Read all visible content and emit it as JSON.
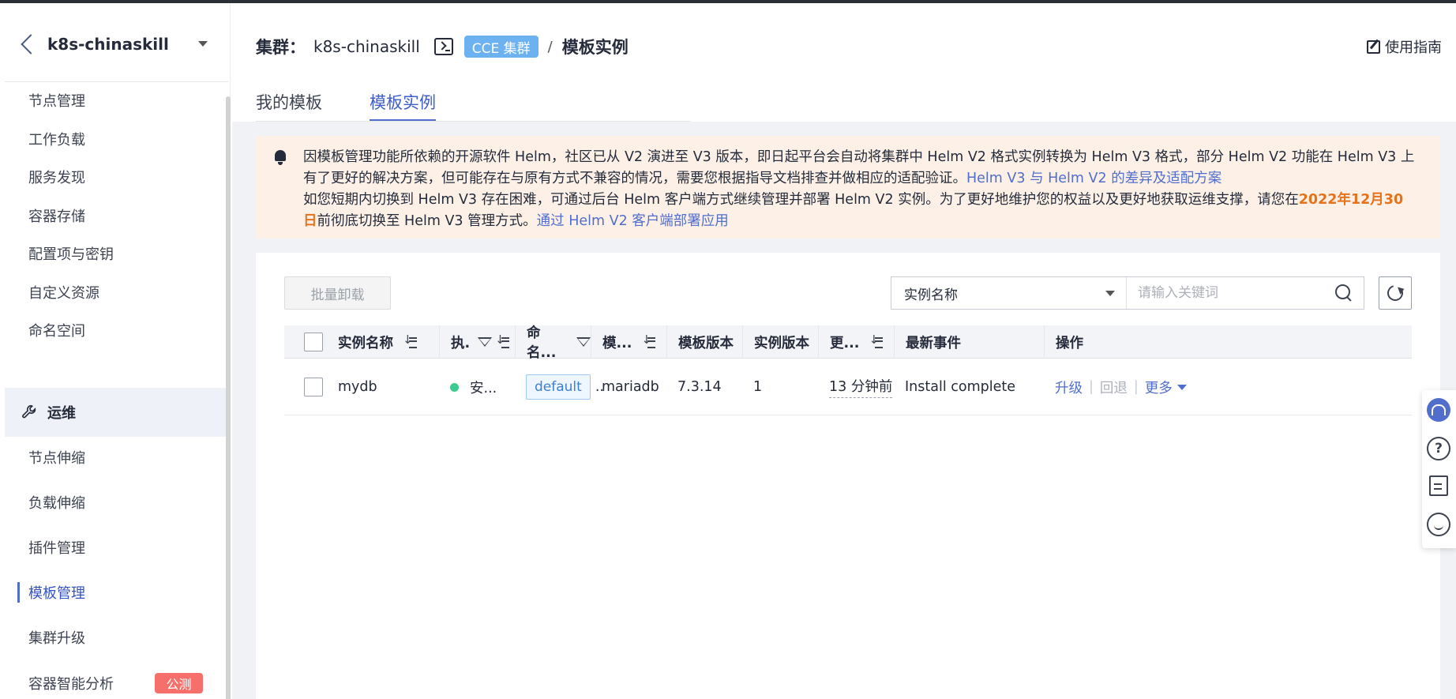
{
  "sidebar": {
    "cluster_name": "k8s-chinaskill",
    "items": [
      {
        "label": "节点管理"
      },
      {
        "label": "工作负载"
      },
      {
        "label": "服务发现"
      },
      {
        "label": "容器存储"
      },
      {
        "label": "配置项与密钥"
      },
      {
        "label": "自定义资源"
      },
      {
        "label": "命名空间"
      }
    ],
    "group_label": "运维",
    "group_items": [
      {
        "label": "节点伸缩"
      },
      {
        "label": "负载伸缩"
      },
      {
        "label": "插件管理"
      },
      {
        "label": "模板管理",
        "active": true
      },
      {
        "label": "集群升级"
      },
      {
        "label": "容器智能分析"
      }
    ],
    "beta_badge": "公测"
  },
  "header": {
    "cluster_label": "集群：",
    "cluster_name": "k8s-chinaskill",
    "cluster_tag": "CCE 集群",
    "separator": "/",
    "current_page": "模板实例",
    "guide_label": "使用指南"
  },
  "tabs": [
    {
      "label": "我的模板",
      "active": false
    },
    {
      "label": "模板实例",
      "active": true
    }
  ],
  "notice": {
    "line1": "因模板管理功能所依赖的开源软件 Helm，社区已从 V2 演进至 V3 版本，即日起平台会自动将集群中 Helm V2 格式实例转换为 Helm V3 格式，部分 Helm V2 功能在 Helm V3 上有了更好的解决方案，但可能存在与原有方式不兼容的情况，需要您根据指导文档排查并做相应的适配验证。",
    "link1": "Helm V3 与 Helm V2 的差异及适配方案",
    "line2_pre": "如您短期内切换到 Helm V3 存在困难，可通过后台 Helm 客户端方式继续管理并部署 Helm V2 实例。为了更好地维护您的权益以及更好地获取运维支撑，请您在",
    "deadline": "2022年12月30日",
    "line2_post": "前彻底切换至 Helm V3 管理方式。",
    "link2": "通过 Helm V2 客户端部署应用"
  },
  "toolbar": {
    "batch_uninstall_label": "批量卸载",
    "search_field_selected": "实例名称",
    "search_placeholder": "请输入关键词"
  },
  "table": {
    "headers": {
      "name": "实例名称",
      "status": "执.",
      "namespace": "命名...",
      "template": "模...",
      "template_version": "模板版本",
      "instance_version": "实例版本",
      "updated": "更...",
      "latest_event": "最新事件",
      "actions": "操作"
    },
    "rows": [
      {
        "name": "mydb",
        "status": "安...",
        "namespace": "default",
        "namespace_more": "..",
        "template": "mariadb",
        "template_version": "7.3.14",
        "instance_version": "1",
        "updated": "13 分钟前",
        "latest_event": "Install complete",
        "action_upgrade": "升级",
        "action_rollback": "回退",
        "action_more": "更多"
      }
    ]
  },
  "colors": {
    "accent": "#526ecc",
    "status_ok": "#3dcc8e",
    "deadline": "#e5731e",
    "notice_bg": "#fdf1e7",
    "badge": "#f66f6a"
  },
  "icons": {
    "back": "chevron-left-icon",
    "dropdown": "caret-down-icon",
    "terminal": "terminal-icon",
    "guide": "edit-doc-icon",
    "notice": "bell-icon",
    "search": "search-icon",
    "refresh": "refresh-icon",
    "sort": "sort-icon",
    "filter": "filter-icon"
  }
}
